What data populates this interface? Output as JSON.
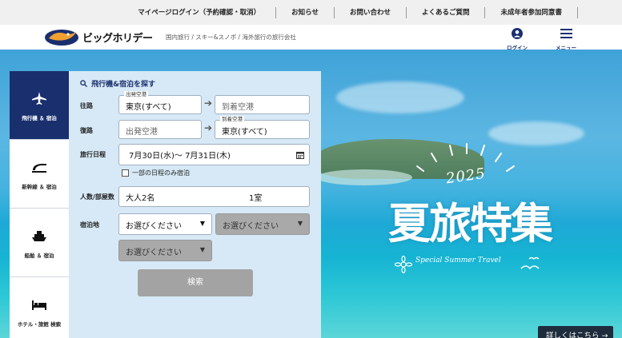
{
  "utility_links": [
    "マイページログイン（予約確認・取消）",
    "お知らせ",
    "お問い合わせ",
    "よくあるご質問",
    "未成年者参加同意書"
  ],
  "header": {
    "logo_text": "ビッグホリデー",
    "tagline": "国内旅行 / スキー&スノボ / 海外旅行の旅行会社",
    "login_label": "ログイン",
    "menu_label": "メニュー"
  },
  "tabs": [
    {
      "label": "飛行機 ＆ 宿泊",
      "icon": "airplane-icon",
      "active": true
    },
    {
      "label": "新幹線 ＆ 宿泊",
      "icon": "train-icon",
      "active": false
    },
    {
      "label": "船舶 ＆ 宿泊",
      "icon": "ship-icon",
      "active": false
    },
    {
      "label": "ホテル・旅館 検索",
      "icon": "bed-icon",
      "active": false
    }
  ],
  "search": {
    "title": "飛行機&宿泊を探す",
    "outbound_label": "往路",
    "outbound_from_caption": "出発空港",
    "outbound_from": "東京(すべて)",
    "outbound_to_placeholder": "到着空港",
    "return_label": "復路",
    "return_from_placeholder": "出発空港",
    "return_to_caption": "到着空港",
    "return_to": "東京(すべて)",
    "dates_label": "旅行日程",
    "dates_value": "7月30日(水)〜  7月31日(木)",
    "partial_stay_label": "一部の日程のみ宿泊",
    "people_label": "人数/部屋数",
    "people_value": "大人2名",
    "rooms_value": "1室",
    "destination_label": "宿泊地",
    "select_placeholder": "お選びください",
    "search_button": "検索"
  },
  "campaign": {
    "year": "2025",
    "title": "夏旅特集",
    "subtitle": "Special Summer Travel",
    "detail_button": "詳しくはこちら →"
  },
  "colors": {
    "navy": "#1a2f6e",
    "panel_bg": "#d7e9f6",
    "util_bg": "#f0f0f0",
    "disabled_button": "#a3a3a3"
  }
}
